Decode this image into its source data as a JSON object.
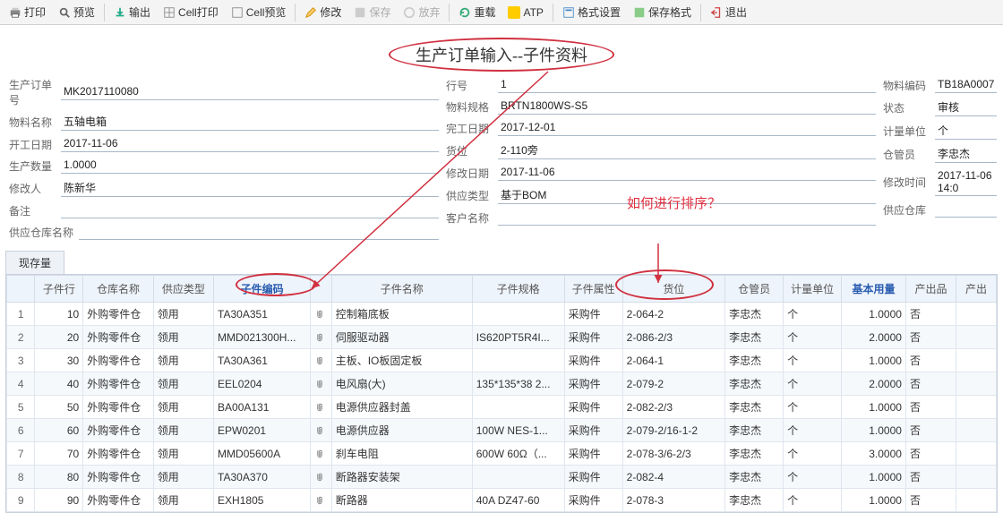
{
  "toolbar": {
    "print": "打印",
    "preview": "预览",
    "export": "输出",
    "cell_print": "Cell打印",
    "cell_preview": "Cell预览",
    "edit": "修改",
    "save": "保存",
    "release": "放弃",
    "reload": "重载",
    "atp": "ATP",
    "format": "格式设置",
    "save_format": "保存格式",
    "exit": "退出"
  },
  "title": "生产订单输入--子件资料",
  "form": {
    "c1": {
      "order_no_l": "生产订单号",
      "order_no": "MK2017110080",
      "mat_name_l": "物料名称",
      "mat_name": "五轴电箱",
      "start_l": "开工日期",
      "start": "2017-11-06",
      "qty_l": "生产数量",
      "qty": "1.0000",
      "mod_by_l": "修改人",
      "mod_by": "陈新华",
      "remark_l": "备注",
      "remark": "",
      "supply_wh_name_l": "供应仓库名称",
      "supply_wh_name": ""
    },
    "c2": {
      "line_l": "行号",
      "line": "1",
      "spec_l": "物料规格",
      "spec": "BRTN1800WS-S5",
      "end_l": "完工日期",
      "end": "2017-12-01",
      "loc_l": "货位",
      "loc": "2-110旁",
      "mod_date_l": "修改日期",
      "mod_date": "2017-11-06",
      "supply_type_l": "供应类型",
      "supply_type": "基于BOM",
      "cust_name_l": "客户名称",
      "cust_name": ""
    },
    "c3": {
      "mat_code_l": "物料编码",
      "mat_code": "TB18A0007",
      "status_l": "状态",
      "status": "审核",
      "uom_l": "计量单位",
      "uom": "个",
      "keeper_l": "仓管员",
      "keeper": "李忠杰",
      "mod_time_l": "修改时间",
      "mod_time": "2017-11-06 14:0",
      "supply_wh_l": "供应仓库",
      "supply_wh": ""
    }
  },
  "tab_stock": "现存量",
  "annot_sort": "如何进行排序？",
  "cols": {
    "rownum": "",
    "line": "子件行",
    "wh": "仓库名称",
    "stype": "供应类型",
    "code": "子件编码",
    "clip": "",
    "name": "子件名称",
    "spec": "子件规格",
    "attr": "子件属性",
    "loc": "货位",
    "keeper": "仓管员",
    "uom": "计量单位",
    "base_qty": "基本用量",
    "output": "产出品",
    "out2": "产出"
  },
  "rows": [
    {
      "n": "1",
      "line": "10",
      "wh": "外购零件仓",
      "stype": "领用",
      "code": "TA30A351",
      "name": "控制箱底板",
      "spec": "",
      "attr": "采购件",
      "loc": "2-064-2",
      "keeper": "李忠杰",
      "uom": "个",
      "qty": "1.0000",
      "out": "否"
    },
    {
      "n": "2",
      "line": "20",
      "wh": "外购零件仓",
      "stype": "领用",
      "code": "MMD021300H...",
      "name": "伺服驱动器",
      "spec": "IS620PT5R4I...",
      "attr": "采购件",
      "loc": "2-086-2/3",
      "keeper": "李忠杰",
      "uom": "个",
      "qty": "2.0000",
      "out": "否"
    },
    {
      "n": "3",
      "line": "30",
      "wh": "外购零件仓",
      "stype": "领用",
      "code": "TA30A361",
      "name": "主板、IO板固定板",
      "spec": "",
      "attr": "采购件",
      "loc": "2-064-1",
      "keeper": "李忠杰",
      "uom": "个",
      "qty": "1.0000",
      "out": "否"
    },
    {
      "n": "4",
      "line": "40",
      "wh": "外购零件仓",
      "stype": "领用",
      "code": "EEL0204",
      "name": "电风扇(大)",
      "spec": "135*135*38 2...",
      "attr": "采购件",
      "loc": "2-079-2",
      "keeper": "李忠杰",
      "uom": "个",
      "qty": "2.0000",
      "out": "否"
    },
    {
      "n": "5",
      "line": "50",
      "wh": "外购零件仓",
      "stype": "领用",
      "code": "BA00A131",
      "name": "电源供应器封盖",
      "spec": "",
      "attr": "采购件",
      "loc": "2-082-2/3",
      "keeper": "李忠杰",
      "uom": "个",
      "qty": "1.0000",
      "out": "否"
    },
    {
      "n": "6",
      "line": "60",
      "wh": "外购零件仓",
      "stype": "领用",
      "code": "EPW0201",
      "name": "电源供应器",
      "spec": "100W NES-1...",
      "attr": "采购件",
      "loc": "2-079-2/16-1-2",
      "keeper": "李忠杰",
      "uom": "个",
      "qty": "1.0000",
      "out": "否"
    },
    {
      "n": "7",
      "line": "70",
      "wh": "外购零件仓",
      "stype": "领用",
      "code": "MMD05600A",
      "name": "刹车电阻",
      "spec": "600W 60Ω（...",
      "attr": "采购件",
      "loc": "2-078-3/6-2/3",
      "keeper": "李忠杰",
      "uom": "个",
      "qty": "3.0000",
      "out": "否"
    },
    {
      "n": "8",
      "line": "80",
      "wh": "外购零件仓",
      "stype": "领用",
      "code": "TA30A370",
      "name": "断路器安装架",
      "spec": "",
      "attr": "采购件",
      "loc": "2-082-4",
      "keeper": "李忠杰",
      "uom": "个",
      "qty": "1.0000",
      "out": "否"
    },
    {
      "n": "9",
      "line": "90",
      "wh": "外购零件仓",
      "stype": "领用",
      "code": "EXH1805",
      "name": "断路器",
      "spec": "40A DZ47-60",
      "attr": "采购件",
      "loc": "2-078-3",
      "keeper": "李忠杰",
      "uom": "个",
      "qty": "1.0000",
      "out": "否"
    }
  ]
}
